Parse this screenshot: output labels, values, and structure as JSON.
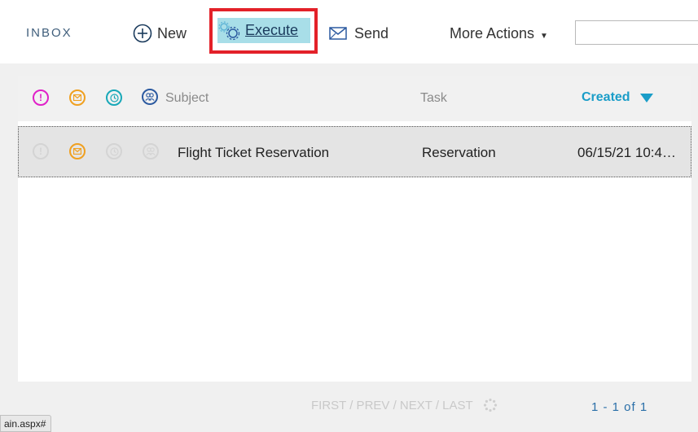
{
  "toolbar": {
    "inbox_title": "INBOX",
    "new_label": "New",
    "execute_label": "Execute",
    "send_label": "Send",
    "more_actions_label": "More Actions",
    "search_value": ""
  },
  "grid": {
    "columns": {
      "subject": "Subject",
      "task": "Task",
      "created": "Created"
    },
    "header_icons": [
      {
        "name": "priority-icon",
        "color": "#e020c8"
      },
      {
        "name": "envelope-icon",
        "color": "#f0a020"
      },
      {
        "name": "clock-icon",
        "color": "#18a8b8"
      },
      {
        "name": "group-icon",
        "color": "#2c5aa0"
      }
    ],
    "rows": [
      {
        "subject": "Flight Ticket Reservation",
        "task": "Reservation",
        "created": "06/15/21 10:4…",
        "unread": true
      }
    ]
  },
  "pager": {
    "links": "FIRST / PREV / NEXT / LAST",
    "count": "1 - 1 of 1"
  },
  "status_bar": {
    "url": "ain.aspx#"
  },
  "colors": {
    "accent": "#1a9dc8",
    "highlight": "#a8dee8",
    "annotation": "#e32129"
  }
}
